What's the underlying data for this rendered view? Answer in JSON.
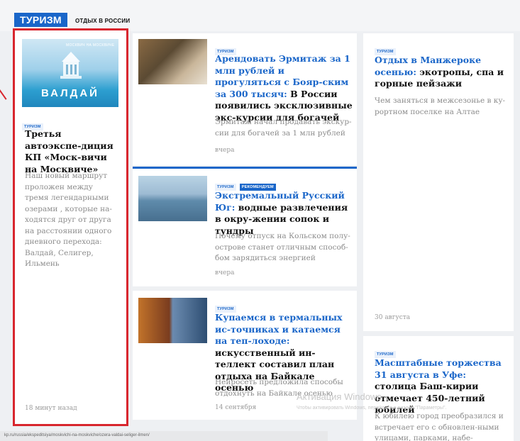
{
  "header": {
    "section_label": "ТУРИЗМ",
    "subnav": "ОТДЫХ В РОССИИ"
  },
  "featured": {
    "image_title": "ВАЛДАЙ",
    "image_logo": "МОСКВИЧ НА МОСКВИЧЕ",
    "tag": "ТУРИЗМ",
    "title": "Третья автоэкспе-диция КП «Моск-вичи на Москвиче»",
    "description": "Наш новый маршрут проложен между тремя легендарными озерами , которые на-ходятся друг от друга на расстоянии одного дневного перехода: Валдай, Селигер, Ильмень",
    "time": "18 минут назад"
  },
  "articles": [
    {
      "tags": [
        "ТУРИЗМ"
      ],
      "title_link": "Арендовать Эрмитаж за 1 млн рублей и прогуляться с Бояр-ским за 300 тысяч:",
      "title_rest": " В России появились эксклюзивные экс-курсии для богачей",
      "description": "Эрмитаж начал продавать экскур-сии для богачей за 1 млн рублей",
      "time": "вчера"
    },
    {
      "tags": [
        "ТУРИЗМ",
        "РЕКОМЕНДУЕМ"
      ],
      "title_link": "Экстремальный Русский Юг:",
      "title_rest": " водные развлечения в окру-жении сопок и тундры",
      "description": "Почему отпуск на Кольском полу-острове станет отличным способ-бом зарядиться энергией",
      "time": "вчера"
    },
    {
      "tags": [
        "ТУРИЗМ"
      ],
      "title_link": "Купаемся в термальных ис-точниках и катаемся на теп-лоходе:",
      "title_rest": " искусственный ин-теллект составил план отдыха на Байкале осенью",
      "description": "Нейросеть предложила способы отдохнуть на Байкале осенью",
      "time": "14 сентября"
    }
  ],
  "right_articles": [
    {
      "tag": "ТУРИЗМ",
      "title_link": "Отдых в Манжероке осенью:",
      "title_rest": " экотропы, спа и горные пейзажи",
      "description": "Чем заняться в межсезонье в ку-рортном поселке на Алтае",
      "time": "30 августа"
    },
    {
      "tag": "ТУРИЗМ",
      "title_link": "Масштабные торжества 31 августа в Уфе:",
      "title_rest": " столица Баш-кирии отмечает 450-летний юбилей",
      "description": "К юбилею город преобразился и встречает его с обновлен-ными улицами, парками, набе-"
    }
  ],
  "watermark": {
    "line1": "Активация Windows",
    "line2": "Чтобы активировать Windows, перейдите в раздел \"Параметры\"."
  },
  "status_url": "kp.ru/russia/ekspeditsiya/moskvichi-na-moskviche/ozera-valdai-seliger-ilmen/",
  "colors": {
    "accent": "#1a66c9",
    "highlight": "#d8262e"
  }
}
